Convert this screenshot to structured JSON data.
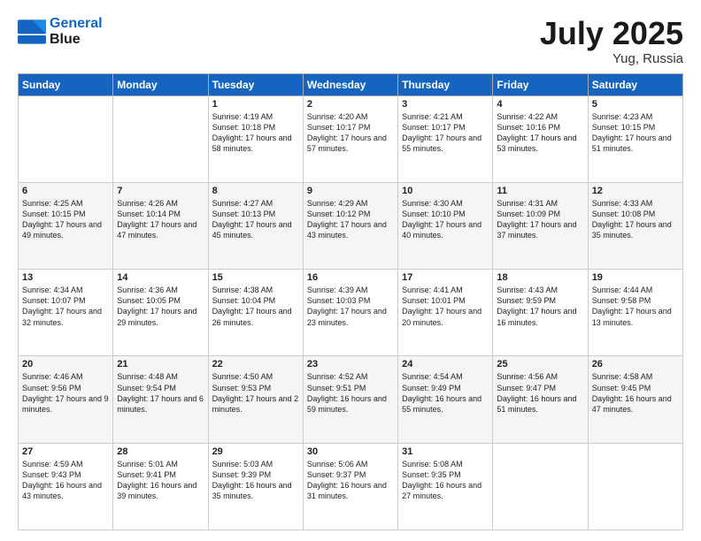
{
  "header": {
    "logo_line1": "General",
    "logo_line2": "Blue",
    "month": "July 2025",
    "location": "Yug, Russia"
  },
  "columns": [
    "Sunday",
    "Monday",
    "Tuesday",
    "Wednesday",
    "Thursday",
    "Friday",
    "Saturday"
  ],
  "weeks": [
    [
      {
        "day": "",
        "text": ""
      },
      {
        "day": "",
        "text": ""
      },
      {
        "day": "1",
        "text": "Sunrise: 4:19 AM\nSunset: 10:18 PM\nDaylight: 17 hours\nand 58 minutes."
      },
      {
        "day": "2",
        "text": "Sunrise: 4:20 AM\nSunset: 10:17 PM\nDaylight: 17 hours\nand 57 minutes."
      },
      {
        "day": "3",
        "text": "Sunrise: 4:21 AM\nSunset: 10:17 PM\nDaylight: 17 hours\nand 55 minutes."
      },
      {
        "day": "4",
        "text": "Sunrise: 4:22 AM\nSunset: 10:16 PM\nDaylight: 17 hours\nand 53 minutes."
      },
      {
        "day": "5",
        "text": "Sunrise: 4:23 AM\nSunset: 10:15 PM\nDaylight: 17 hours\nand 51 minutes."
      }
    ],
    [
      {
        "day": "6",
        "text": "Sunrise: 4:25 AM\nSunset: 10:15 PM\nDaylight: 17 hours\nand 49 minutes."
      },
      {
        "day": "7",
        "text": "Sunrise: 4:26 AM\nSunset: 10:14 PM\nDaylight: 17 hours\nand 47 minutes."
      },
      {
        "day": "8",
        "text": "Sunrise: 4:27 AM\nSunset: 10:13 PM\nDaylight: 17 hours\nand 45 minutes."
      },
      {
        "day": "9",
        "text": "Sunrise: 4:29 AM\nSunset: 10:12 PM\nDaylight: 17 hours\nand 43 minutes."
      },
      {
        "day": "10",
        "text": "Sunrise: 4:30 AM\nSunset: 10:10 PM\nDaylight: 17 hours\nand 40 minutes."
      },
      {
        "day": "11",
        "text": "Sunrise: 4:31 AM\nSunset: 10:09 PM\nDaylight: 17 hours\nand 37 minutes."
      },
      {
        "day": "12",
        "text": "Sunrise: 4:33 AM\nSunset: 10:08 PM\nDaylight: 17 hours\nand 35 minutes."
      }
    ],
    [
      {
        "day": "13",
        "text": "Sunrise: 4:34 AM\nSunset: 10:07 PM\nDaylight: 17 hours\nand 32 minutes."
      },
      {
        "day": "14",
        "text": "Sunrise: 4:36 AM\nSunset: 10:05 PM\nDaylight: 17 hours\nand 29 minutes."
      },
      {
        "day": "15",
        "text": "Sunrise: 4:38 AM\nSunset: 10:04 PM\nDaylight: 17 hours\nand 26 minutes."
      },
      {
        "day": "16",
        "text": "Sunrise: 4:39 AM\nSunset: 10:03 PM\nDaylight: 17 hours\nand 23 minutes."
      },
      {
        "day": "17",
        "text": "Sunrise: 4:41 AM\nSunset: 10:01 PM\nDaylight: 17 hours\nand 20 minutes."
      },
      {
        "day": "18",
        "text": "Sunrise: 4:43 AM\nSunset: 9:59 PM\nDaylight: 17 hours\nand 16 minutes."
      },
      {
        "day": "19",
        "text": "Sunrise: 4:44 AM\nSunset: 9:58 PM\nDaylight: 17 hours\nand 13 minutes."
      }
    ],
    [
      {
        "day": "20",
        "text": "Sunrise: 4:46 AM\nSunset: 9:56 PM\nDaylight: 17 hours\nand 9 minutes."
      },
      {
        "day": "21",
        "text": "Sunrise: 4:48 AM\nSunset: 9:54 PM\nDaylight: 17 hours\nand 6 minutes."
      },
      {
        "day": "22",
        "text": "Sunrise: 4:50 AM\nSunset: 9:53 PM\nDaylight: 17 hours\nand 2 minutes."
      },
      {
        "day": "23",
        "text": "Sunrise: 4:52 AM\nSunset: 9:51 PM\nDaylight: 16 hours\nand 59 minutes."
      },
      {
        "day": "24",
        "text": "Sunrise: 4:54 AM\nSunset: 9:49 PM\nDaylight: 16 hours\nand 55 minutes."
      },
      {
        "day": "25",
        "text": "Sunrise: 4:56 AM\nSunset: 9:47 PM\nDaylight: 16 hours\nand 51 minutes."
      },
      {
        "day": "26",
        "text": "Sunrise: 4:58 AM\nSunset: 9:45 PM\nDaylight: 16 hours\nand 47 minutes."
      }
    ],
    [
      {
        "day": "27",
        "text": "Sunrise: 4:59 AM\nSunset: 9:43 PM\nDaylight: 16 hours\nand 43 minutes."
      },
      {
        "day": "28",
        "text": "Sunrise: 5:01 AM\nSunset: 9:41 PM\nDaylight: 16 hours\nand 39 minutes."
      },
      {
        "day": "29",
        "text": "Sunrise: 5:03 AM\nSunset: 9:39 PM\nDaylight: 16 hours\nand 35 minutes."
      },
      {
        "day": "30",
        "text": "Sunrise: 5:06 AM\nSunset: 9:37 PM\nDaylight: 16 hours\nand 31 minutes."
      },
      {
        "day": "31",
        "text": "Sunrise: 5:08 AM\nSunset: 9:35 PM\nDaylight: 16 hours\nand 27 minutes."
      },
      {
        "day": "",
        "text": ""
      },
      {
        "day": "",
        "text": ""
      }
    ]
  ]
}
